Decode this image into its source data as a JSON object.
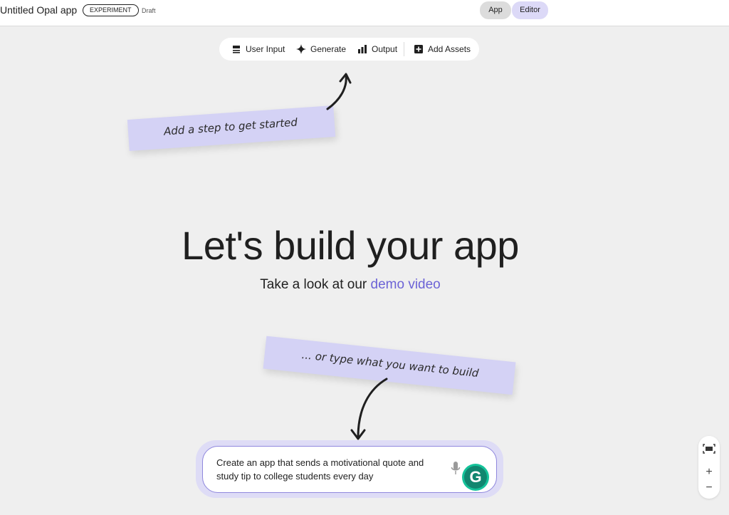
{
  "header": {
    "app_title": "Untitled Opal app",
    "badge": "EXPERIMENT",
    "status": "Draft",
    "modes": {
      "app": "App",
      "editor": "Editor",
      "active": "Editor"
    }
  },
  "toolbar": {
    "user_input": "User Input",
    "generate": "Generate",
    "output": "Output",
    "add_assets": "Add Assets"
  },
  "notes": {
    "step_hint": "Add a step to get started",
    "type_hint": "... or type what you want to build"
  },
  "hero": {
    "title": "Let's build your app",
    "subtitle_prefix": "Take a look at our ",
    "subtitle_link": "demo video"
  },
  "prompt": {
    "value": "Create an app that sends a motivational quote and study tip to college students every day",
    "grammarly_letter": "G"
  },
  "zoom": {
    "zoom_in": "+",
    "zoom_out": "−"
  },
  "colors": {
    "accent": "#6c63d6",
    "note_bg": "#d4d2f5",
    "editor_active": "#dcd9f7"
  }
}
